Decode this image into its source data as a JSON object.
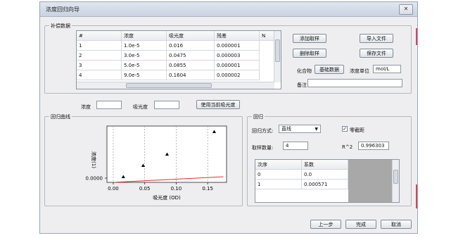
{
  "window": {
    "title": "浓度回归向导",
    "close_glyph": "✕"
  },
  "supplement": {
    "group_label": "补偿数据",
    "columns": [
      "#",
      "浓度",
      "吸光度",
      "残差",
      "N"
    ],
    "rows": [
      [
        "1",
        "1.0e-5",
        "0.016",
        "0.000001"
      ],
      [
        "2",
        "3.0e-5",
        "0.0475",
        "0.000003"
      ],
      [
        "3",
        "5.0e-5",
        "0.0855",
        "0.000001"
      ],
      [
        "4",
        "9.0e-5",
        "0.1604",
        "0.000002"
      ]
    ],
    "buttons": {
      "add": "添加取样",
      "delete": "删除取样",
      "import": "导入文件",
      "save": "保存文件",
      "compound": "基础数据"
    },
    "compound_label": "化合物",
    "unit_label": "浓度单位",
    "unit_value": "mol/L",
    "remark_label": "备注",
    "remark_value": ""
  },
  "entry": {
    "conc_label": "浓度",
    "conc_value": "",
    "abs_label": "吸光度",
    "abs_value": "",
    "use_current_button": "使用当前吸光度"
  },
  "plot": {
    "group_label": "回归曲线",
    "ylabel": "浓度(1)",
    "xlabel": "吸光度 (OD)",
    "y_tick": "0.0000"
  },
  "chart_data": {
    "type": "scatter",
    "xlabel": "吸光度 (OD)",
    "ylabel": "浓度(1)",
    "x_ticks": [
      "0.00",
      "0.05",
      "0.10",
      "0.15"
    ],
    "y_ticks": [
      "0.0000"
    ],
    "xlim": [
      -0.01,
      0.18
    ],
    "grid": true,
    "points": [
      {
        "x": 0.016,
        "y": 1e-05
      },
      {
        "x": 0.0475,
        "y": 3e-05
      },
      {
        "x": 0.0855,
        "y": 5e-05
      },
      {
        "x": 0.1604,
        "y": 9e-05
      }
    ],
    "fit": {
      "slope": 0.000571,
      "intercept": 0.0
    },
    "colors": {
      "fit_line": "#e03030",
      "points": "#000000"
    }
  },
  "regression": {
    "group_label": "回归",
    "method_label": "回归方式:",
    "method_value": "直线",
    "zero_intercept_label": "零截距",
    "zero_intercept_checked": true,
    "sample_count_label": "取样数量:",
    "sample_count_value": "4",
    "r2_label": "R^2",
    "r2_value": "0.996303",
    "coef_columns": [
      "次序",
      "系数"
    ],
    "coef_rows": [
      [
        "0",
        "0.0"
      ],
      [
        "1",
        "0.000571"
      ]
    ]
  },
  "footer": {
    "prev": "上一步",
    "finish": "完成",
    "cancel": "取消"
  }
}
